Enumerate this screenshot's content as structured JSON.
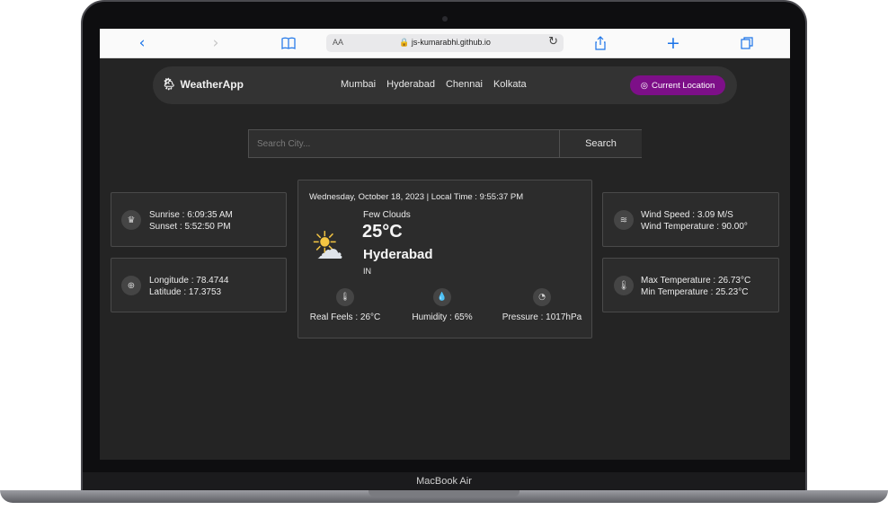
{
  "device": {
    "label": "MacBook Air"
  },
  "browser": {
    "url": "js-kumarabhi.github.io",
    "text_size_label": "AA",
    "icons": [
      "back-icon",
      "forward-icon",
      "bookmarks-icon",
      "lock-icon",
      "reload-icon",
      "share-icon",
      "new-tab-icon",
      "tabs-icon"
    ]
  },
  "nav": {
    "brand": "WeatherApp",
    "cities": [
      "Mumbai",
      "Hyderabad",
      "Chennai",
      "Kolkata"
    ],
    "location_button": "Current Location"
  },
  "search": {
    "placeholder": "Search City...",
    "button": "Search"
  },
  "left_cards": {
    "sun": {
      "sunrise": "Sunrise : 6:09:35 AM",
      "sunset": "Sunset : 5:52:50 PM"
    },
    "coords": {
      "longitude": "Longitude : 78.4744",
      "latitude": "Latitude : 17.3753"
    }
  },
  "main": {
    "datetime": "Wednesday, October 18, 2023 | Local Time : 9:55:37 PM",
    "condition": "Few Clouds",
    "temperature": "25°C",
    "city": "Hyderabad",
    "country": "IN",
    "real_feels": "Real Feels : 26°C",
    "humidity": "Humidity : 65%",
    "pressure": "Pressure : 1017hPa"
  },
  "right_cards": {
    "wind": {
      "speed": "Wind Speed : 3.09 M/S",
      "temperature": "Wind Temperature : 90.00°"
    },
    "temps": {
      "max": "Max Temperature : 26.73°C",
      "min": "Min Temperature : 25.23°C"
    }
  },
  "colors": {
    "accent": "#7d0f88",
    "background": "#242424",
    "card": "#2c2c2c"
  }
}
